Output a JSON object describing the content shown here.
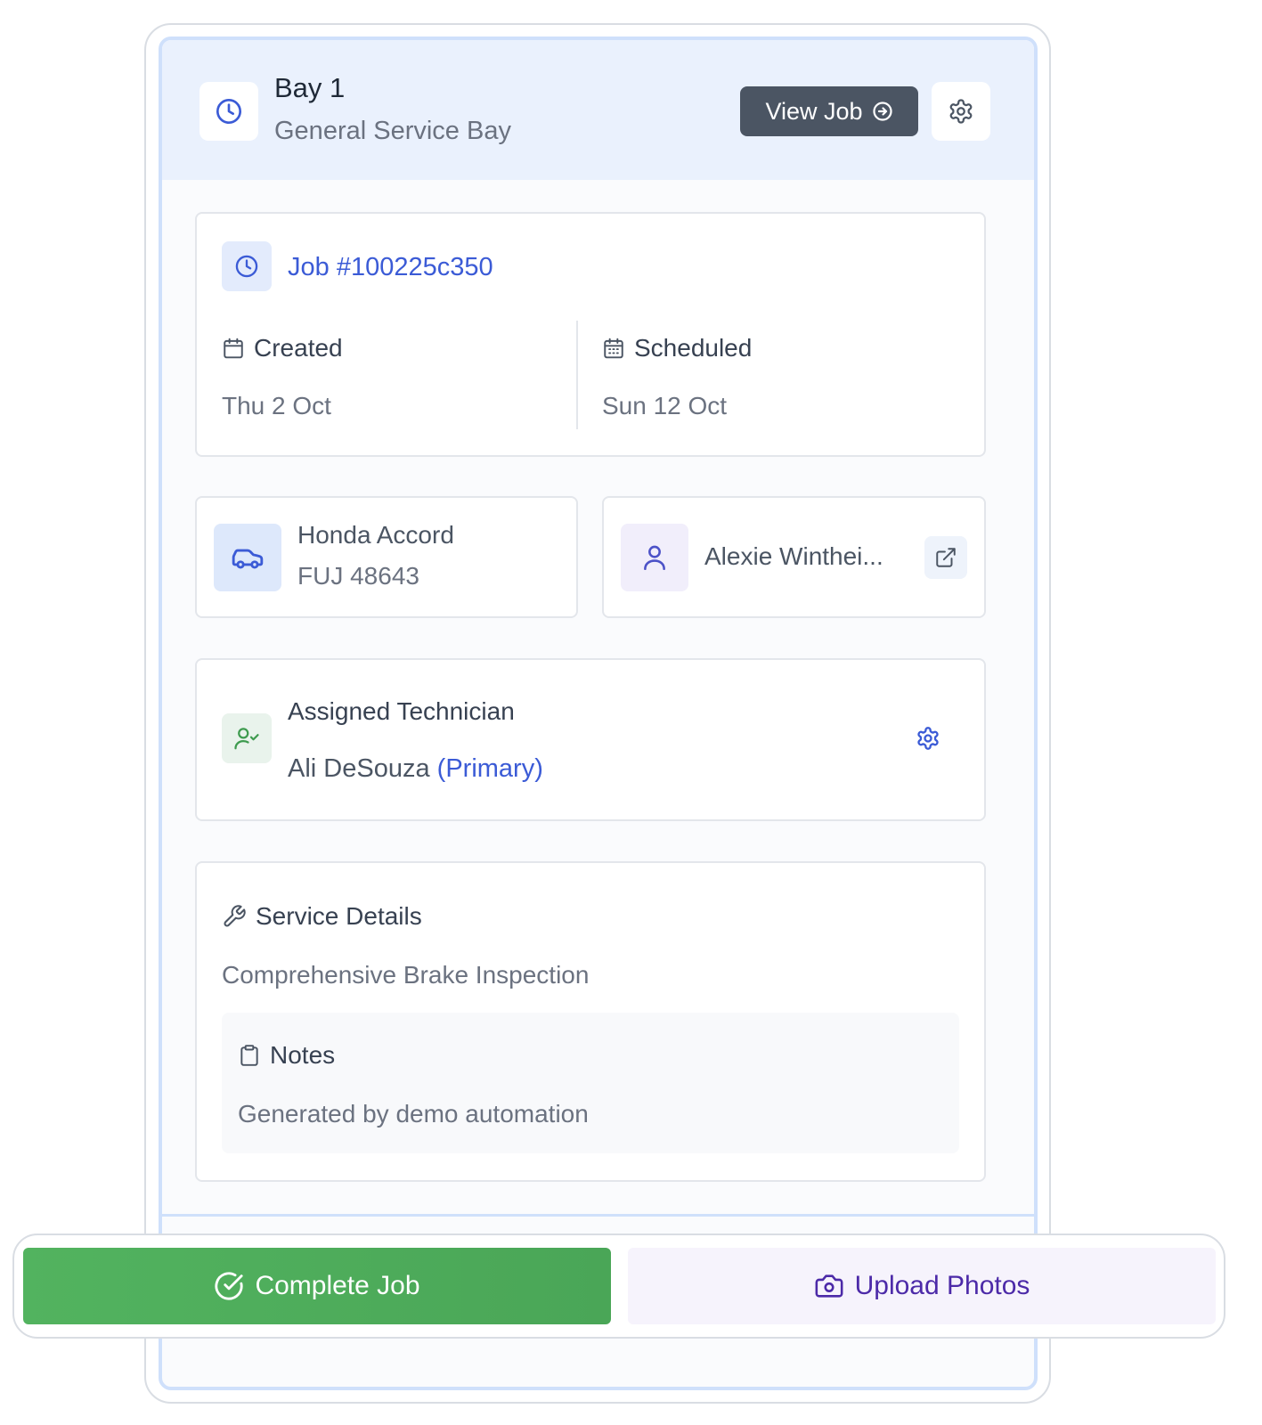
{
  "bay": {
    "title": "Bay 1",
    "subtitle": "General Service Bay",
    "view_job_label": "View Job"
  },
  "job": {
    "number": "Job #100225c350",
    "created_label": "Created",
    "created_value": "Thu 2 Oct",
    "scheduled_label": "Scheduled",
    "scheduled_value": "Sun 12 Oct"
  },
  "vehicle": {
    "name": "Honda Accord",
    "plate": "FUJ 48643"
  },
  "customer": {
    "name": "Alexie Winthei..."
  },
  "technician": {
    "title": "Assigned Technician",
    "name": "Ali DeSouza",
    "role": "(Primary)"
  },
  "service": {
    "title": "Service Details",
    "description": "Comprehensive Brake Inspection",
    "notes_title": "Notes",
    "notes_text": "Generated by demo automation"
  },
  "actions": {
    "complete_label": "Complete Job",
    "upload_label": "Upload Photos"
  },
  "colors": {
    "accent_blue": "#3b5bd6",
    "header_bg": "#eaf1fd",
    "complete_green": "#4caf50",
    "upload_purple": "#4c2aa8"
  },
  "icons": {
    "bay": "clock-icon",
    "settings": "gear-icon",
    "view_job": "arrow-circle-right-icon",
    "created": "calendar-icon",
    "scheduled": "calendar-grid-icon",
    "vehicle": "car-icon",
    "customer": "user-icon",
    "external": "external-link-icon",
    "technician": "user-check-icon",
    "service": "wrench-icon",
    "notes": "clipboard-icon",
    "complete": "check-circle-icon",
    "upload": "camera-icon"
  }
}
